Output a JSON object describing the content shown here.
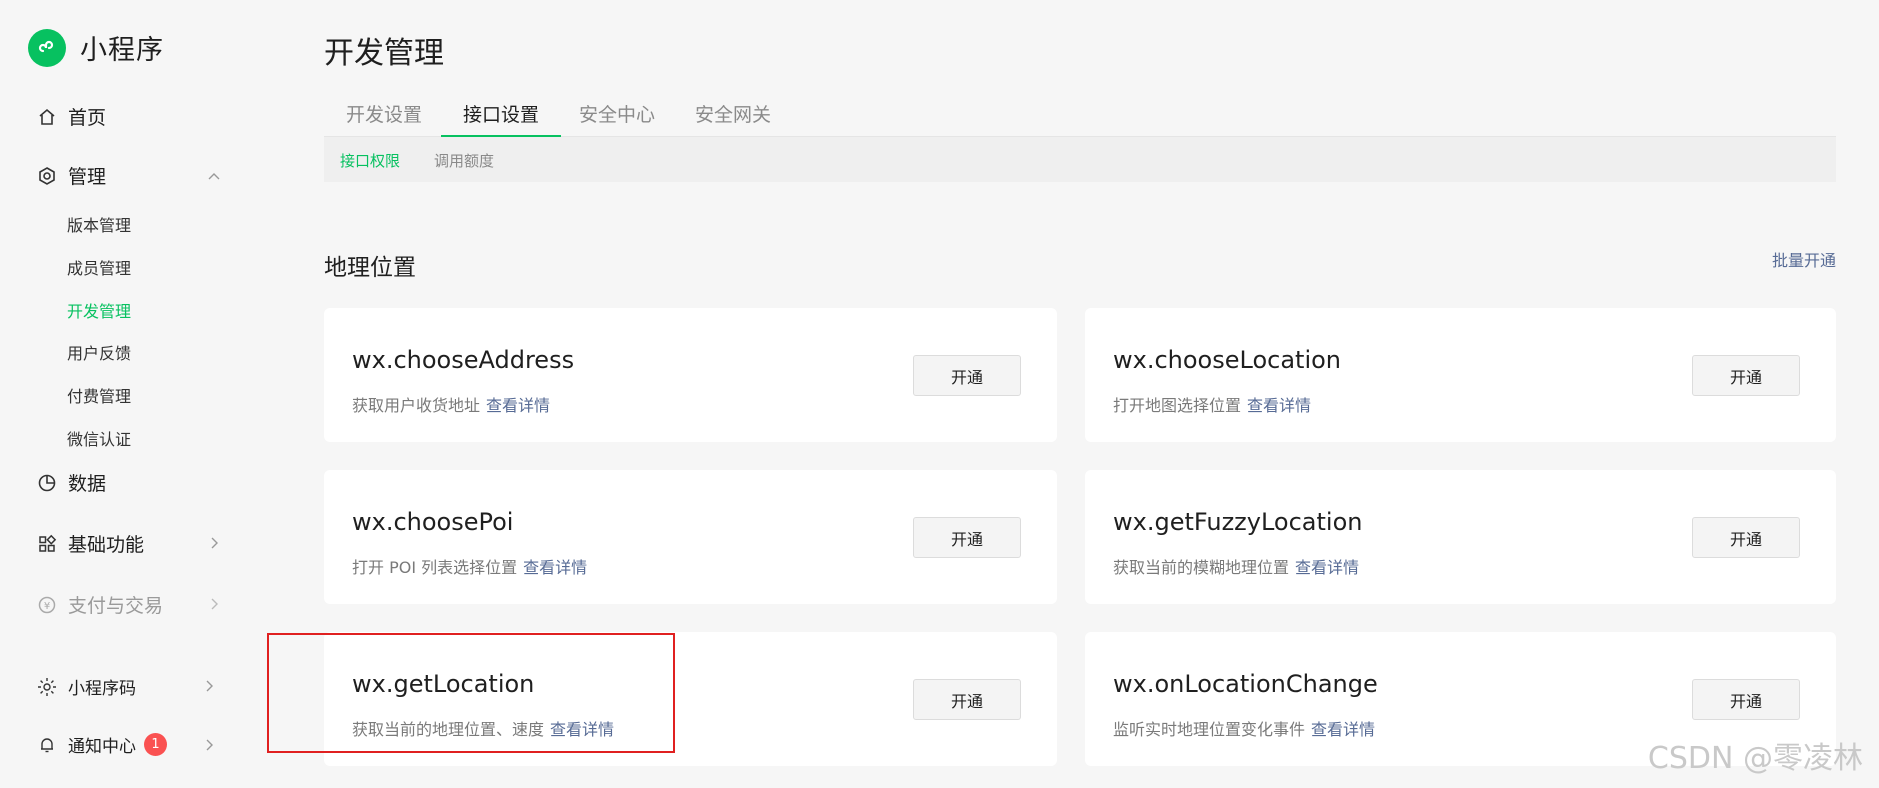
{
  "app": {
    "name": "小程序"
  },
  "sidebar": {
    "items": [
      {
        "label": "首页"
      },
      {
        "label": "管理"
      },
      {
        "label": "数据"
      },
      {
        "label": "基础功能"
      },
      {
        "label": "支付与交易"
      },
      {
        "label": "小程序码"
      },
      {
        "label": "通知中心",
        "badge": "1"
      }
    ],
    "manage_sub": [
      "版本管理",
      "成员管理",
      "开发管理",
      "用户反馈",
      "付费管理",
      "微信认证"
    ],
    "active_sub": "开发管理"
  },
  "page": {
    "title": "开发管理",
    "tabs": [
      "开发设置",
      "接口设置",
      "安全中心",
      "安全网关"
    ],
    "active_tab": "接口设置",
    "subtabs": [
      "接口权限",
      "调用额度"
    ],
    "active_subtab": "接口权限"
  },
  "section": {
    "title": "地理位置",
    "batch_label": "批量开通",
    "detail_label": "查看详情",
    "open_label": "开通",
    "apis": [
      {
        "name": "wx.chooseAddress",
        "desc": "获取用户收货地址"
      },
      {
        "name": "wx.chooseLocation",
        "desc": "打开地图选择位置"
      },
      {
        "name": "wx.choosePoi",
        "desc": "打开 POI 列表选择位置"
      },
      {
        "name": "wx.getFuzzyLocation",
        "desc": "获取当前的模糊地理位置"
      },
      {
        "name": "wx.getLocation",
        "desc": "获取当前的地理位置、速度"
      },
      {
        "name": "wx.onLocationChange",
        "desc": "监听实时地理位置变化事件"
      }
    ]
  },
  "colors": {
    "brand": "#07c160",
    "link": "#576b95",
    "badge": "#fa5151",
    "highlight": "#e02020"
  },
  "watermark": "CSDN @零凌林"
}
